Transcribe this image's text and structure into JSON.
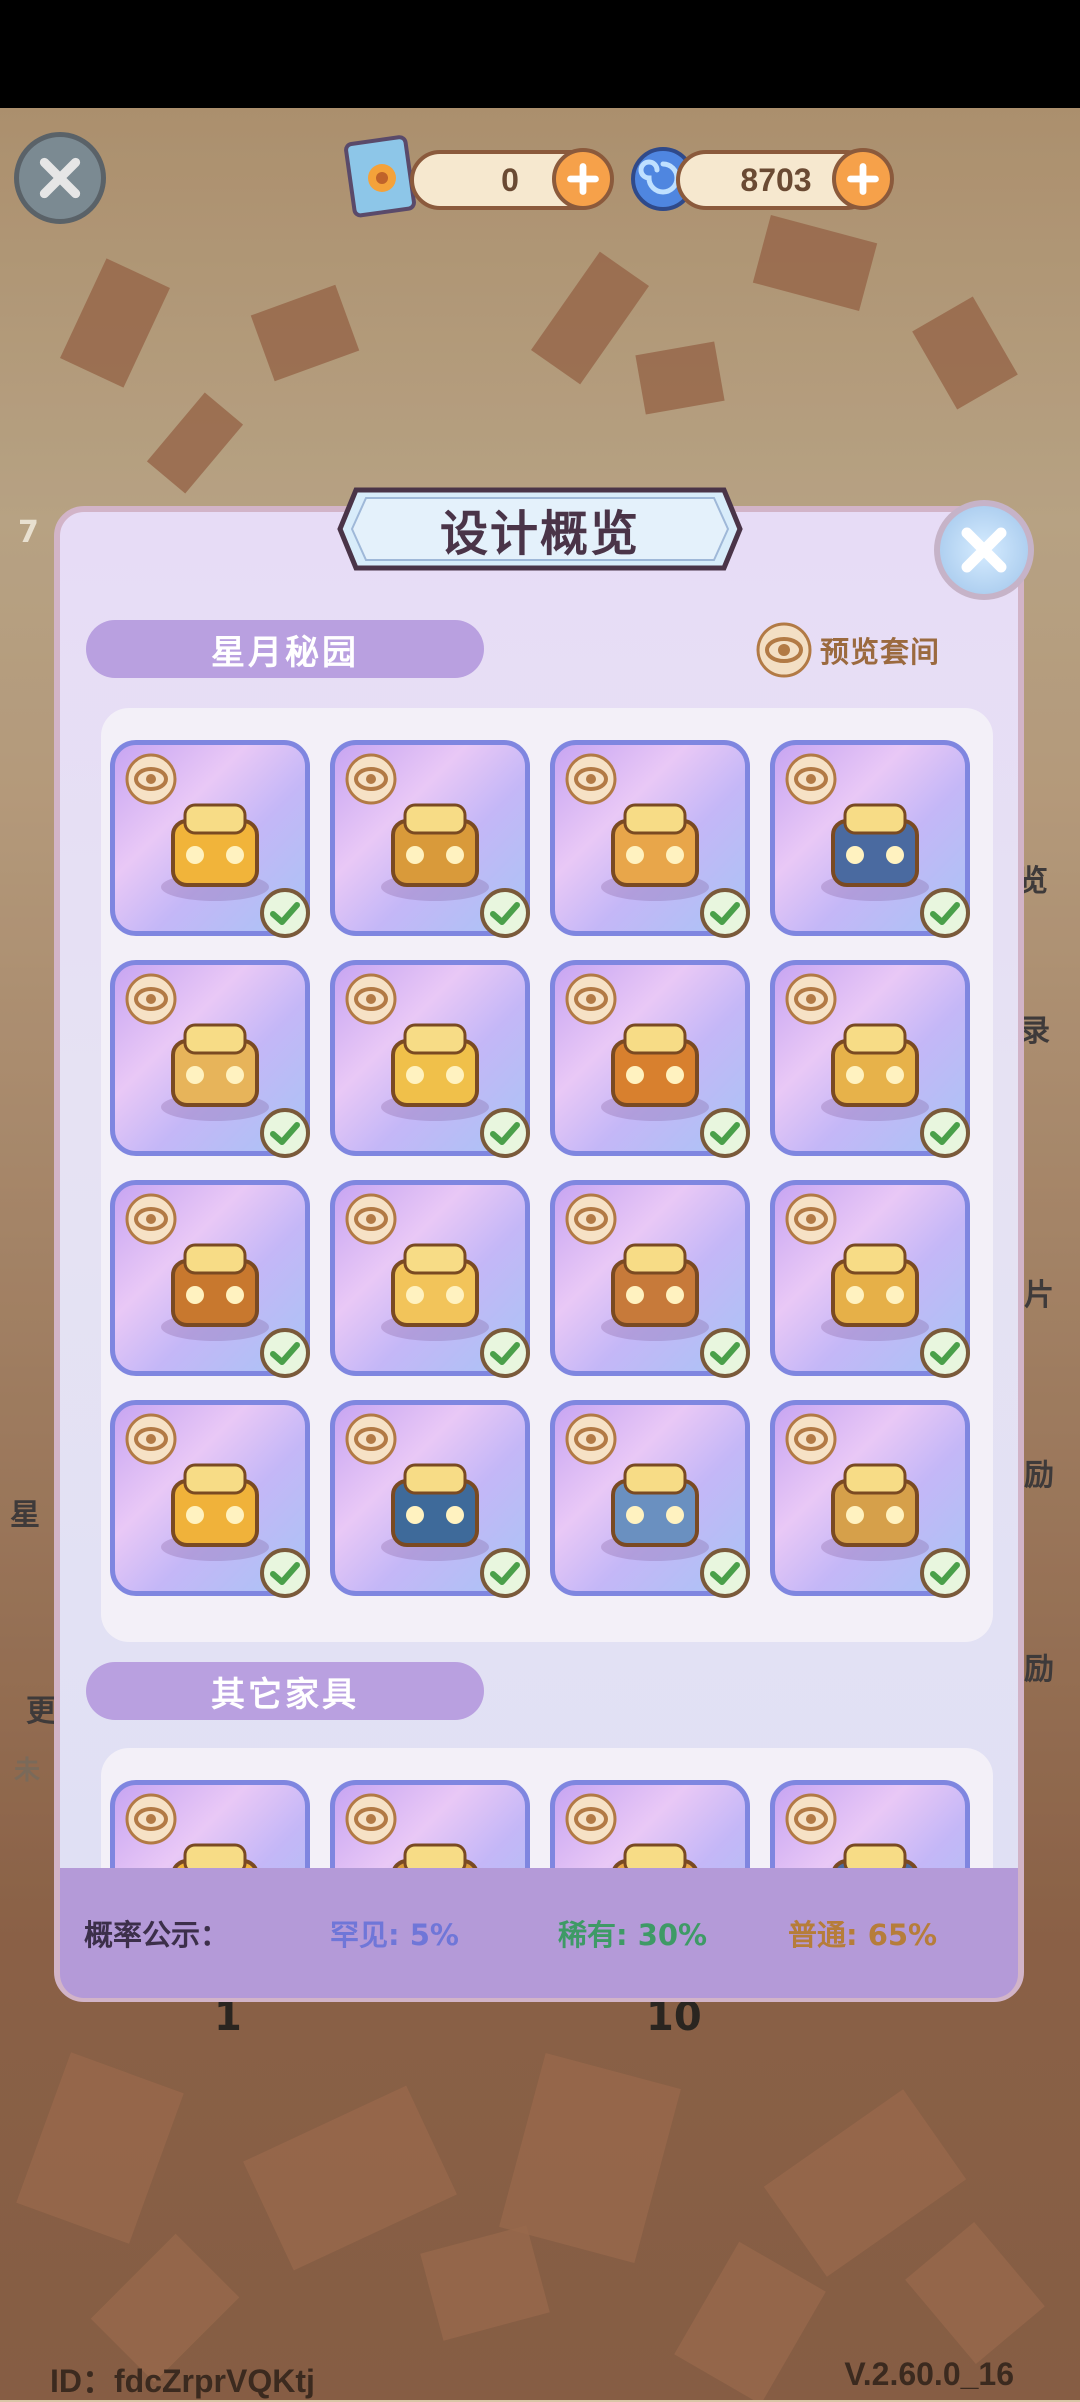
{
  "currencies": [
    {
      "icon": "flower-ticket-icon",
      "value": "0"
    },
    {
      "icon": "swirl-gem-icon",
      "value": "8703"
    }
  ],
  "modal": {
    "title": "设计概览",
    "section1": "星月秘园",
    "preview_link": "预览套间",
    "section2": "其它家具",
    "items": [
      {
        "name": "sunflower-planter",
        "icon": "sunflower-planter-icon"
      },
      {
        "name": "sunflower-hammock",
        "icon": "hammock-icon"
      },
      {
        "name": "fruit-picnic-candle",
        "icon": "fruit-basket-icon"
      },
      {
        "name": "blue-iris-plant",
        "icon": "iris-plant-icon"
      },
      {
        "name": "round-lace-rug",
        "icon": "round-rug-icon"
      },
      {
        "name": "yellow-armchair",
        "icon": "armchair-icon"
      },
      {
        "name": "orange-sofa",
        "icon": "sofa-icon"
      },
      {
        "name": "canopy-bed",
        "icon": "bed-icon"
      },
      {
        "name": "wood-cabinet",
        "icon": "cabinet-icon"
      },
      {
        "name": "yellow-table",
        "icon": "table-icon"
      },
      {
        "name": "tall-bookcase",
        "icon": "bookcase-icon"
      },
      {
        "name": "side-table",
        "icon": "side-table-icon"
      },
      {
        "name": "sunflower-vase",
        "icon": "sunflower-vase-icon"
      },
      {
        "name": "curtain-window",
        "icon": "curtain-window-icon"
      },
      {
        "name": "narrow-window",
        "icon": "narrow-window-icon"
      },
      {
        "name": "wide-window",
        "icon": "wide-window-icon"
      }
    ],
    "other_items": [
      {
        "name": "blue-floral-blanket",
        "icon": "blanket-icon"
      },
      {
        "name": "mirror-frame",
        "icon": "mirror-icon"
      },
      {
        "name": "wood-stand",
        "icon": "stand-icon"
      },
      {
        "name": "wood-chair",
        "icon": "chair-icon"
      }
    ],
    "odds_label": "概率公示：",
    "odds": [
      {
        "label": "罕见: 5%",
        "color": "#6f76d8"
      },
      {
        "label": "稀有: 30%",
        "color": "#3e9a66"
      },
      {
        "label": "普通: 65%",
        "color": "#b67d3a"
      }
    ]
  },
  "peek_text": {
    "a": "7",
    "b": "览",
    "c": "录",
    "d": "片",
    "e": "励",
    "f": "励",
    "g": "星",
    "h": "更",
    "i": "未",
    "j": "1",
    "k": "10"
  },
  "footer": {
    "id": "ID：fdcZrprVQKtj",
    "version": "V.2.60.0_16"
  }
}
